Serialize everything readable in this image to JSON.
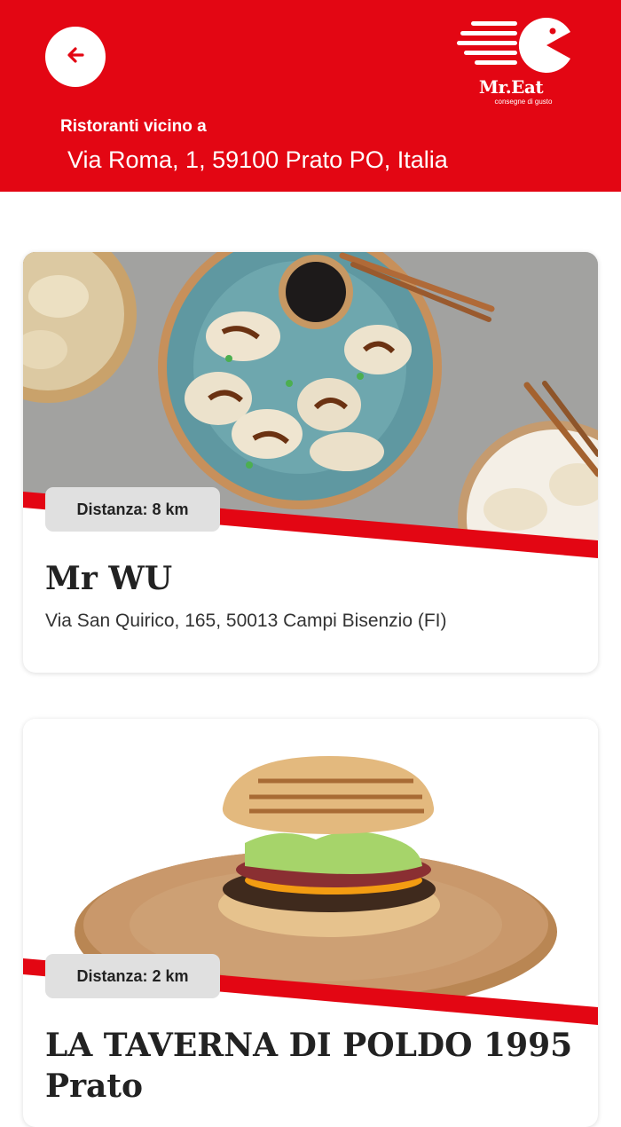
{
  "header": {
    "back_icon": "arrow-left-icon",
    "logo": {
      "name": "Mr.Eat",
      "tagline": "consegne di gusto"
    },
    "near_label": "Ristoranti vicino a",
    "address": "Via Roma, 1, 59100 Prato PO, Italia"
  },
  "colors": {
    "brand_red": "#e30613",
    "badge_gray": "#e0e0e0"
  },
  "restaurants": [
    {
      "name": "Mr WU",
      "address": "Via San Quirico, 165, 50013 Campi Bisenzio (FI)",
      "distance": "Distanza: 8 km",
      "image": "dumplings-photo"
    },
    {
      "name": "LA TAVERNA DI POLDO 1995 Prato",
      "address": "",
      "distance": "Distanza: 2 km",
      "image": "burger-photo"
    }
  ]
}
